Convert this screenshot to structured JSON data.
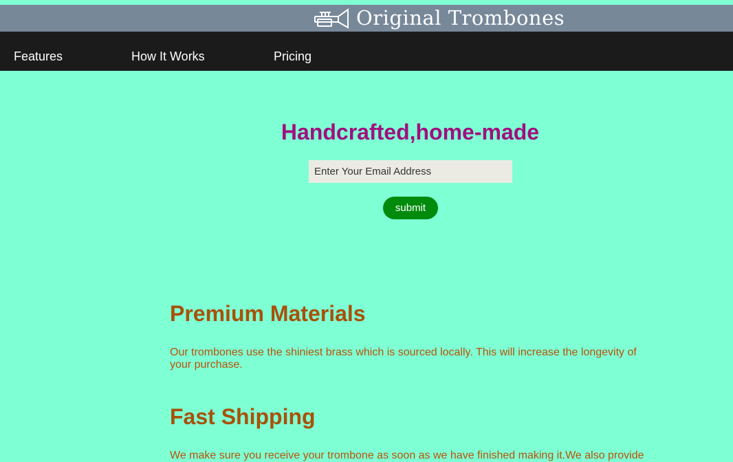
{
  "header": {
    "logo_text": "Original Trombones",
    "logo_icon": "trumpet-logo-icon"
  },
  "nav": {
    "items": [
      {
        "label": "Features"
      },
      {
        "label": "How It Works"
      },
      {
        "label": "Pricing"
      }
    ]
  },
  "hero": {
    "title": "Handcrafted,home-made",
    "email_placeholder": "Enter Your Email Address",
    "submit_label": "submit"
  },
  "features": [
    {
      "title": "Premium Materials",
      "text": "Our trombones use the shiniest brass which is sourced locally. This will increase the longevity of your purchase."
    },
    {
      "title": "Fast Shipping",
      "text": "We make sure you receive your trombone as soon as we have finished making it.We also provide"
    }
  ],
  "colors": {
    "page_background": "#7fffd4",
    "header_background": "#778899",
    "nav_background": "#1b1b1b",
    "hero_title": "#a0107e",
    "submit_button": "#008b0c",
    "feature_text": "#b8520a"
  }
}
